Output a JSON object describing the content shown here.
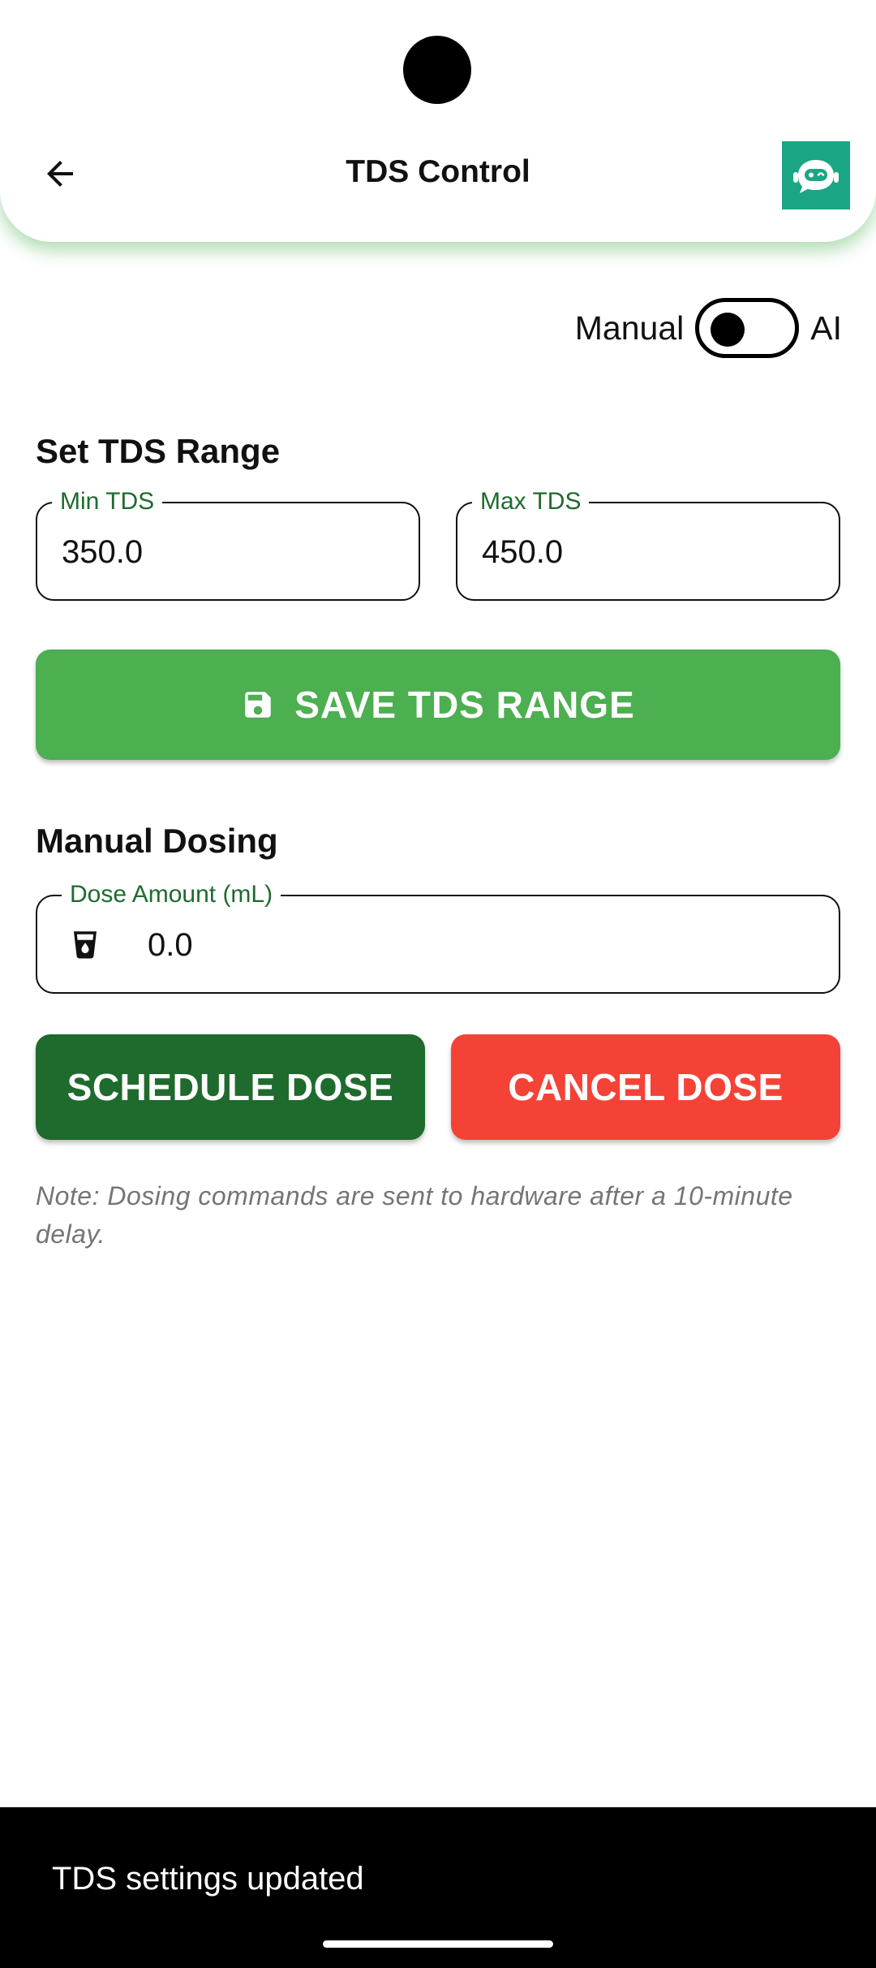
{
  "header": {
    "title": "TDS Control"
  },
  "mode": {
    "left_label": "Manual",
    "right_label": "AI",
    "value": "Manual"
  },
  "range_section": {
    "title": "Set TDS Range",
    "min_label": "Min TDS",
    "min_value": "350.0",
    "max_label": "Max TDS",
    "max_value": "450.0",
    "save_label": "SAVE TDS RANGE"
  },
  "dosing_section": {
    "title": "Manual Dosing",
    "dose_label": "Dose Amount (mL)",
    "dose_value": "0.0",
    "schedule_label": "SCHEDULE DOSE",
    "cancel_label": "CANCEL DOSE",
    "note": "Note: Dosing commands are sent to hardware after a 10-minute delay."
  },
  "snackbar": {
    "message": "TDS settings updated"
  },
  "colors": {
    "primary_green": "#4caf50",
    "dark_green": "#1e6b2d",
    "danger_red": "#f44336",
    "bot_teal": "#1aa584"
  },
  "icons": {
    "back": "arrow-left-icon",
    "assistant": "robot-icon",
    "save": "floppy-disk-icon",
    "dose": "cup-drop-icon"
  }
}
